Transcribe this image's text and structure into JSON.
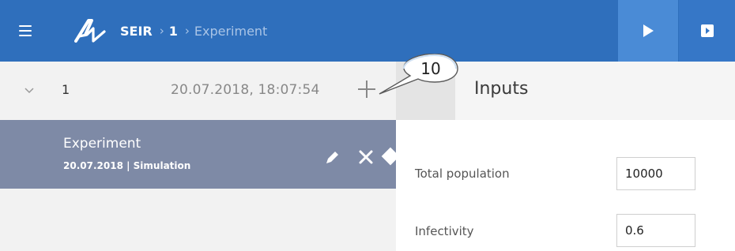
{
  "header": {
    "breadcrumb": {
      "app": "SEIR",
      "separator_1": "›",
      "run": "1",
      "separator_2": "›",
      "current": "Experiment"
    },
    "icons": [
      "menu-icon",
      "app-logo",
      "play-icon",
      "stop-icon"
    ],
    "colors": {
      "bar": "#2f6fbc",
      "run_button": "#4a8bd6",
      "stop_button": "#3677c7"
    }
  },
  "sidebar": {
    "run": {
      "number": "1",
      "timestamp": "20.07.2018, 18:07:54"
    },
    "experiment": {
      "title": "Experiment",
      "subtitle": "20.07.2018 | Simulation",
      "color": "#7e8aa6"
    }
  },
  "inputs": {
    "title": "Inputs",
    "fields": [
      {
        "label": "Total population",
        "value": "10000"
      },
      {
        "label": "Infectivity",
        "value": "0.6"
      }
    ]
  },
  "annotation": {
    "callout_number": "10"
  }
}
